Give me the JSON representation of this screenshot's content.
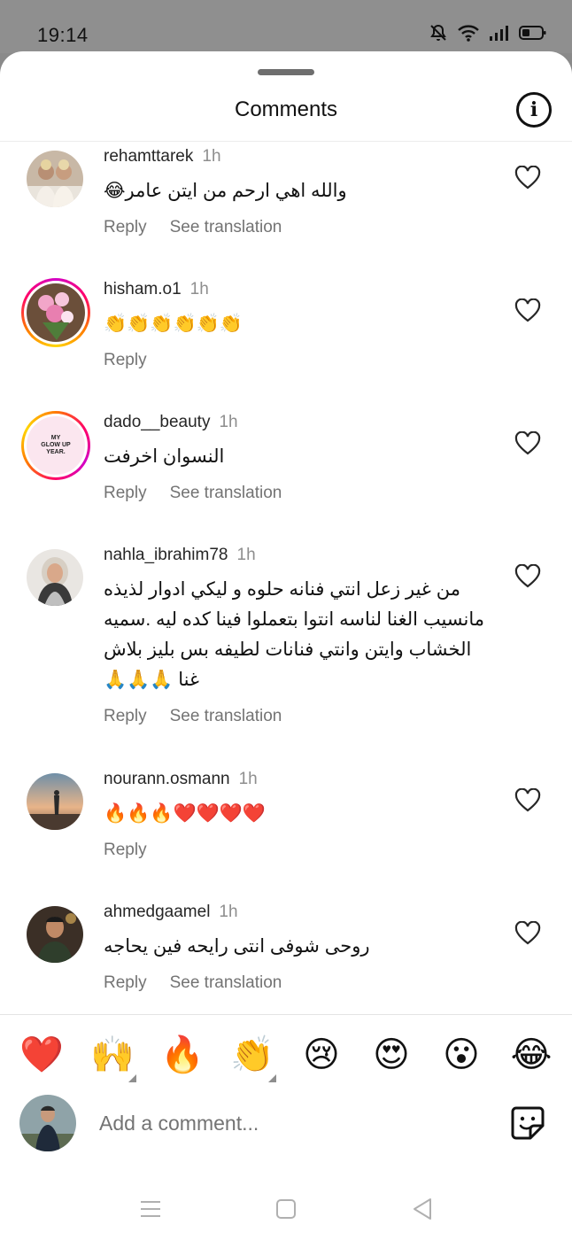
{
  "status_bar": {
    "time": "19:14"
  },
  "header": {
    "title": "Comments",
    "info_icon": "info-icon"
  },
  "comments": [
    {
      "username": "rehamttarek",
      "time": "1h",
      "text": "والله اهي ارحم من ايتن عامر😂",
      "reply": "Reply",
      "see_translation": "See translation"
    },
    {
      "username": "hisham.o1",
      "time": "1h",
      "text": "👏👏👏👏👏👏",
      "reply": "Reply"
    },
    {
      "username": "dado__beauty",
      "time": "1h",
      "text": "النسوان اخرفت",
      "reply": "Reply",
      "see_translation": "See translation",
      "avatar_text": "MY GLOW UP YEAR."
    },
    {
      "username": "nahla_ibrahim78",
      "time": "1h",
      "text": "من غير زعل انتي فنانه حلوه و ليكي ادوار لذيذه مانسيب الغنا لناسه انتوا بتعملوا فينا كده ليه .سميه الخشاب وايتن وانتي فنانات لطيفه بس بليز بلاش غنا 🙏🙏🙏",
      "reply": "Reply",
      "see_translation": "See translation"
    },
    {
      "username": "nourann.osmann",
      "time": "1h",
      "text": "🔥🔥🔥❤️❤️❤️❤️",
      "reply": "Reply"
    },
    {
      "username": "ahmedgaamel",
      "time": "1h",
      "text": "روحى شوفى انتى رايحه فين يحاجه",
      "reply": "Reply",
      "see_translation": "See translation"
    }
  ],
  "emoji_bar": [
    "❤️",
    "🙌",
    "🔥",
    "👏",
    "😢",
    "😍",
    "😮",
    "😂"
  ],
  "composer": {
    "placeholder": "Add a comment..."
  },
  "colors": {
    "muted_text": "#737373",
    "time_text": "#8e8e8e",
    "story_ring_start": "#d300c5",
    "story_ring_end": "#ffd600"
  }
}
